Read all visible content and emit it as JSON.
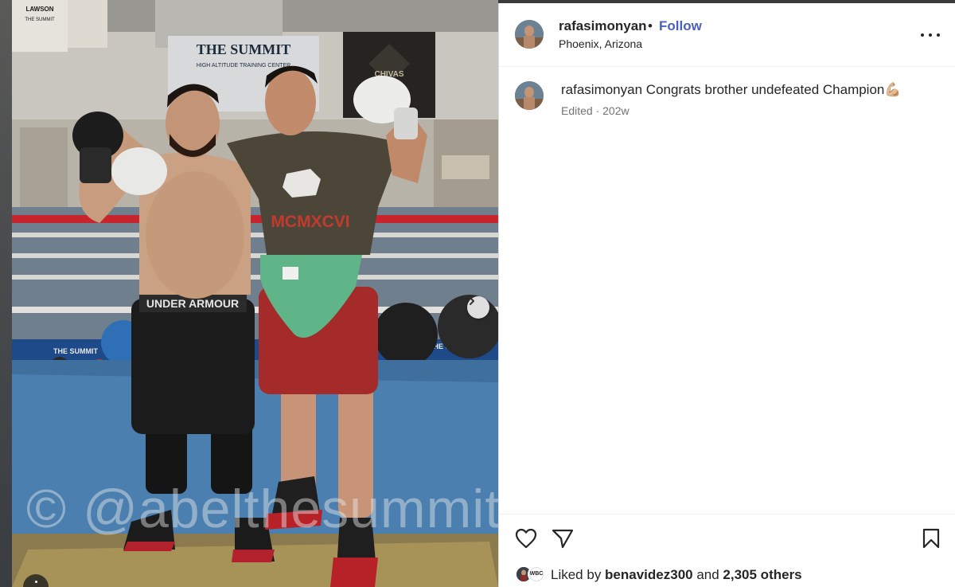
{
  "photo": {
    "watermark": "© @abelthesummit",
    "banner_top": "THE SUMMIT",
    "banner_sub": "HIGH ALTITUDE TRAINING CENTER",
    "shirt_text": "MCMXCVI",
    "ring_brand": "CHIVAS",
    "ring_apron": "THE SUMMIT",
    "waistband": "UNDER ARMOUR",
    "poster_left": "LAWSON",
    "poster_left_sub": "THE SUMMIT",
    "next_icon": "chevron-right-icon",
    "more_icon": "ellipsis-icon"
  },
  "post": {
    "username": "rafasimonyan",
    "separator": "•",
    "follow_label": "Follow",
    "location": "Phoenix, Arizona",
    "more_icon": "ellipsis-horizontal-icon"
  },
  "comment": {
    "username": "rafasimonyan",
    "text": " Congrats brother undefeated Champion💪🏼",
    "meta": "Edited · 202w"
  },
  "actions": {
    "like_icon": "heart-icon",
    "share_icon": "paper-plane-icon",
    "save_icon": "bookmark-icon"
  },
  "likes": {
    "prefix": "Liked by ",
    "user": "benavidez300",
    "middle": " and ",
    "others": "2,305 others",
    "avatar2_label": "WBC"
  },
  "colors": {
    "follow": "#4a5fc1",
    "text": "#262626",
    "muted": "#737373"
  }
}
